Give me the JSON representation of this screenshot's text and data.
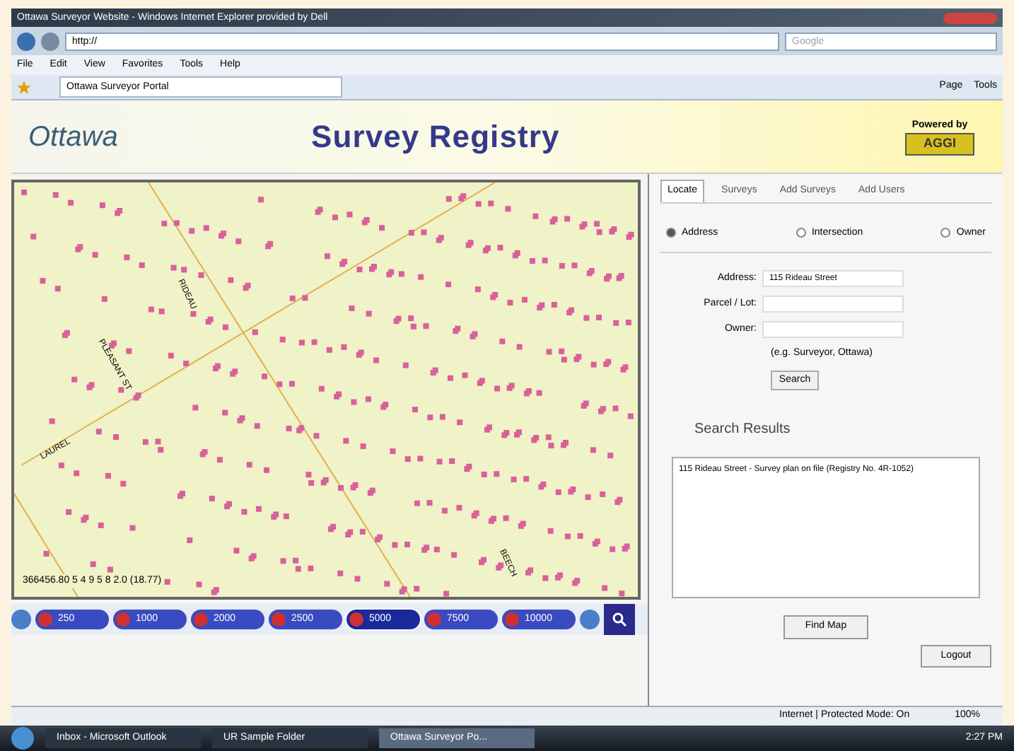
{
  "window": {
    "title": "Ottawa Surveyor Website - Windows Internet Explorer provided by Dell"
  },
  "address_bar": {
    "value": "http://"
  },
  "search_box": {
    "placeholder": "Google"
  },
  "menu": [
    "File",
    "Edit",
    "View",
    "Favorites",
    "Tools",
    "Help"
  ],
  "browser_tab": {
    "label": "Ottawa Surveyor Portal"
  },
  "toolbar": [
    "Page",
    "Tools"
  ],
  "header": {
    "logo": "Ottawa",
    "title": "Survey Registry",
    "powered_by": "Powered by",
    "brand": "AGGI"
  },
  "map": {
    "coordinates": "366456.80 5 4 9 5 8 2.0 (18.77)",
    "streets": [
      "RIDEAU",
      "PLEASANT ST",
      "LAUREL",
      "BEECH"
    ]
  },
  "scales": [
    {
      "label": "250",
      "selected": false
    },
    {
      "label": "1000",
      "selected": false
    },
    {
      "label": "2000",
      "selected": false
    },
    {
      "label": "2500",
      "selected": false
    },
    {
      "label": "5000",
      "selected": true
    },
    {
      "label": "7500",
      "selected": false
    },
    {
      "label": "10000",
      "selected": false
    }
  ],
  "tabs": [
    {
      "label": "Locate",
      "selected": true
    },
    {
      "label": "Surveys",
      "selected": false
    },
    {
      "label": "Add Surveys",
      "selected": false
    },
    {
      "label": "Add Users",
      "selected": false
    }
  ],
  "search_by": [
    {
      "label": "Address",
      "selected": true
    },
    {
      "label": "Intersection",
      "selected": false
    },
    {
      "label": "Owner",
      "selected": false
    }
  ],
  "fields": [
    {
      "label": "Address:",
      "value": "115 Rideau Street"
    },
    {
      "label": "Parcel / Lot:"
    },
    {
      "label": "Owner:"
    }
  ],
  "hint": "(e.g. Surveyor, Ottawa)",
  "search_button": "Search",
  "results": {
    "heading": "Search Results",
    "lines": [
      "115 Rideau Street - Survey plan on file (Registry No. 4R-1052)"
    ]
  },
  "find_map_button": "Find Map",
  "logout_button": "Logout",
  "status_bar": {
    "zone": "Internet | Protected Mode: On",
    "zoom": "100%"
  },
  "taskbar": [
    {
      "label": "Inbox - Microsoft Outlook",
      "selected": false
    },
    {
      "label": "UR Sample Folder",
      "selected": false
    },
    {
      "label": "Ottawa Surveyor Po...",
      "selected": true
    }
  ],
  "clock": "2:27 PM"
}
